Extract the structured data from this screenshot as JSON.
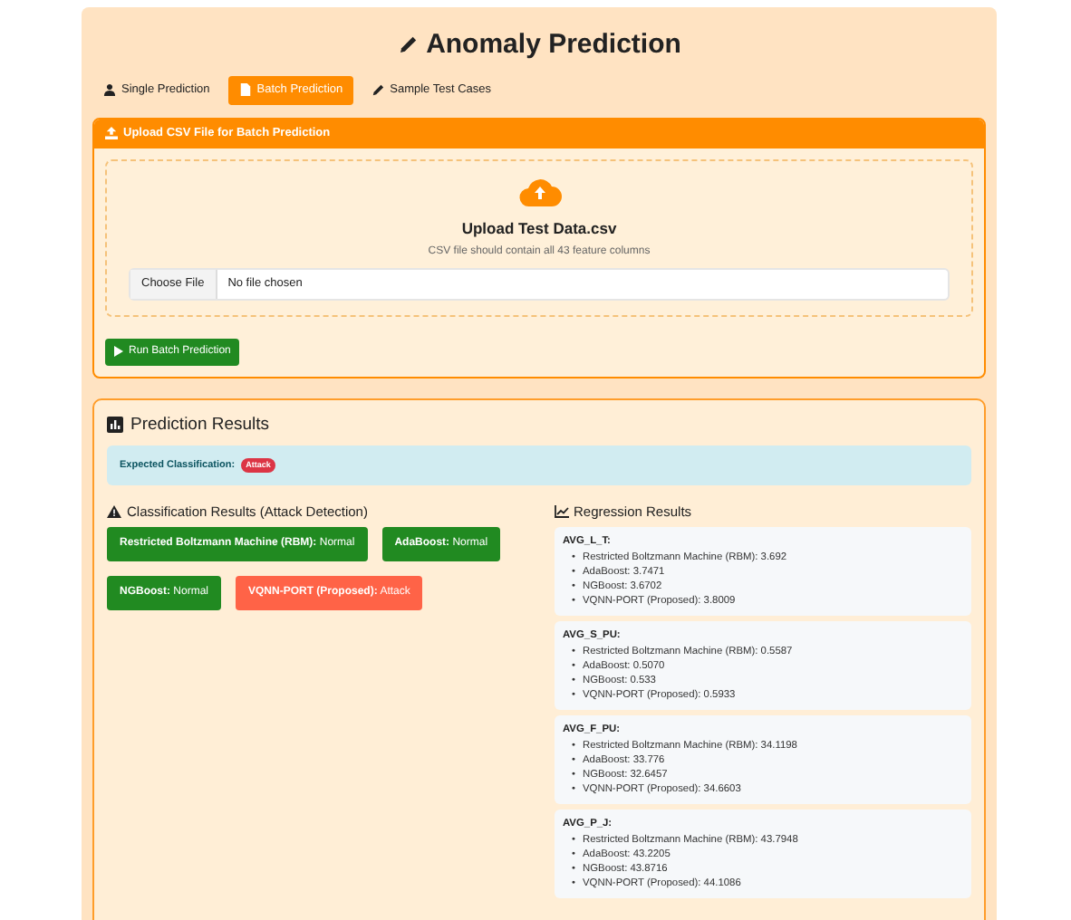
{
  "title": "Anomaly Prediction",
  "tabs": [
    {
      "label": "Single Prediction",
      "selected": false
    },
    {
      "label": "Batch Prediction",
      "selected": true
    },
    {
      "label": "Sample Test Cases",
      "selected": false
    }
  ],
  "upload": {
    "header": "Upload CSV File for Batch Prediction",
    "heading": "Upload Test Data.csv",
    "hint": "CSV file should contain all 43 feature columns",
    "file_button": "Choose File",
    "file_status": "No file chosen",
    "run_button": "Run Batch Prediction"
  },
  "results": {
    "title": "Prediction Results",
    "expected_label": "Expected Classification:",
    "expected_badge": "Attack",
    "classification_title": "Classification Results (Attack Detection)",
    "classification": [
      {
        "model": "Restricted Boltzmann Machine (RBM):",
        "result": "Normal",
        "kind": "normal"
      },
      {
        "model": "AdaBoost:",
        "result": "Normal",
        "kind": "normal"
      },
      {
        "model": "NGBoost:",
        "result": "Normal",
        "kind": "normal"
      },
      {
        "model": "VQNN-PORT (Proposed):",
        "result": "Attack",
        "kind": "attack"
      }
    ],
    "regression_title": "Regression Results",
    "bullet": "•",
    "regression": [
      {
        "name": "AVG_L_T:",
        "items": [
          "Restricted Boltzmann Machine (RBM): 3.692",
          "AdaBoost: 3.7471",
          "NGBoost: 3.6702",
          "VQNN-PORT (Proposed): 3.8009"
        ]
      },
      {
        "name": "AVG_S_PU:",
        "items": [
          "Restricted Boltzmann Machine (RBM): 0.5587",
          "AdaBoost: 0.5070",
          "NGBoost: 0.533",
          "VQNN-PORT (Proposed): 0.5933"
        ]
      },
      {
        "name": "AVG_F_PU:",
        "items": [
          "Restricted Boltzmann Machine (RBM): 34.1198",
          "AdaBoost: 33.776",
          "NGBoost: 32.6457",
          "VQNN-PORT (Proposed): 34.6603"
        ]
      },
      {
        "name": "AVG_P_J:",
        "items": [
          "Restricted Boltzmann Machine (RBM): 43.7948",
          "AdaBoost: 43.2205",
          "NGBoost: 43.8716",
          "VQNN-PORT (Proposed): 44.1086"
        ]
      }
    ]
  }
}
